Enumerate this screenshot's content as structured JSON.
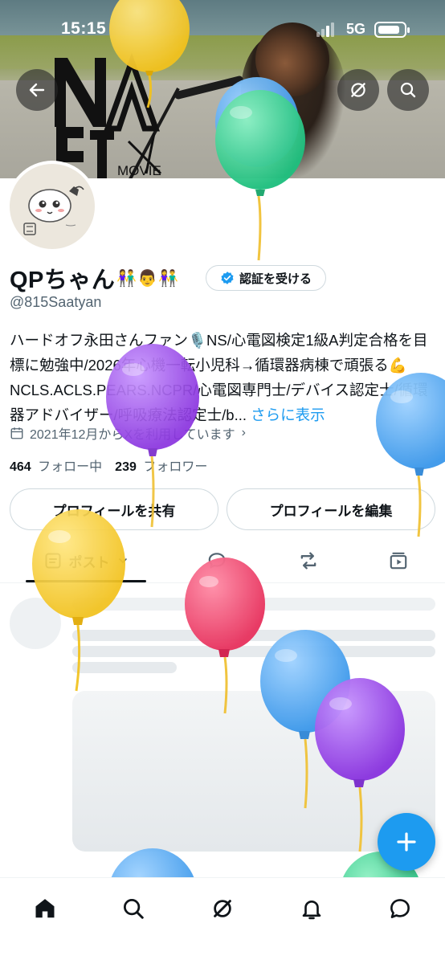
{
  "status_bar": {
    "time": "15:15",
    "network": "5G"
  },
  "banner": {
    "logo_text": "MOVIE"
  },
  "header": {
    "back_icon": "arrow-left-icon",
    "grok_icon": "grok-icon",
    "search_icon": "search-icon"
  },
  "profile": {
    "display_name": "QPちゃん",
    "name_emoji": "👫👨👫",
    "verify_button": "認証を受ける",
    "handle": "@815Saatyan",
    "bio": "ハードオフ永田さんファン🎙️NS/心電図検定1級A判定合格を目標に勉強中/2026年心機一転小児科→循環器病棟で頑張る💪NCLS.ACLS.PEARS.NCPR/心電図専門士/デバイス認定士/循環器アドバイザー/呼吸療法認定士/b...",
    "bio_more": "さらに表示",
    "joined": "2021年12月からXを利用しています",
    "following_count": "464",
    "following_label": "フォロー中",
    "followers_count": "239",
    "followers_label": "フォロワー",
    "share_button": "プロフィールを共有",
    "edit_button": "プロフィールを編集"
  },
  "tabs": [
    {
      "label": "ポスト",
      "icon": "posts-icon",
      "active": true
    },
    {
      "label": "",
      "icon": "replies-icon",
      "active": false
    },
    {
      "label": "",
      "icon": "repost-icon",
      "active": false
    },
    {
      "label": "",
      "icon": "media-icon",
      "active": false
    }
  ],
  "bottom_nav": [
    {
      "icon": "home-icon",
      "active": true
    },
    {
      "icon": "search-icon",
      "active": false
    },
    {
      "icon": "grok-icon",
      "active": false
    },
    {
      "icon": "notifications-icon",
      "active": false
    },
    {
      "icon": "messages-icon",
      "active": false
    }
  ],
  "fab": {
    "icon": "plus-icon"
  },
  "colors": {
    "accent": "#1d9bf0",
    "text": "#0f1419",
    "muted": "#536471"
  },
  "balloon_colors": [
    "#f7cc2e",
    "#4aa7f0",
    "#2ec98a",
    "#9b45e8",
    "#ee3f6d"
  ]
}
